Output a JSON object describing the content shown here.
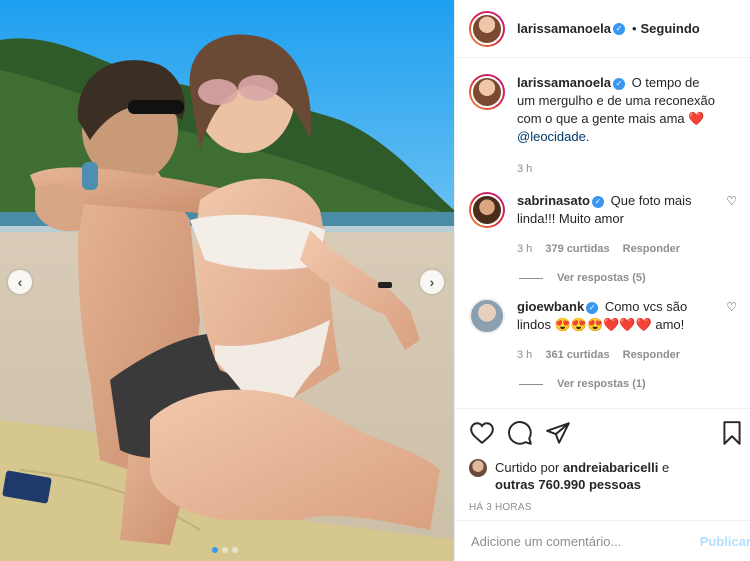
{
  "post": {
    "author": "larissamanoela",
    "follow_status": "Seguindo",
    "bullet": "•"
  },
  "caption": {
    "username": "larissamanoela",
    "text": "O tempo de um mergulho e de uma reconexão com o que a gente mais ama",
    "emoji": "❤️",
    "mention": "@leocidade.",
    "time": "3 h"
  },
  "comments": [
    {
      "username": "sabrinasato",
      "text": "Que foto mais linda!!! Muito amor",
      "time": "3 h",
      "likes": "379 curtidas",
      "reply": "Responder",
      "view_replies": "Ver respostas (5)"
    },
    {
      "username": "gioewbank",
      "text": "Como vcs são lindos",
      "emojis": "😍😍😍❤️❤️❤️",
      "text_end": "amo!",
      "time": "3 h",
      "likes": "361 curtidas",
      "reply": "Responder",
      "view_replies": "Ver respostas (1)"
    }
  ],
  "likes": {
    "prefix": "Curtido por",
    "user": "andreiabaricelli",
    "mid": "e",
    "others_prefix": "outras",
    "others_count": "760.990",
    "others_suffix": "pessoas"
  },
  "timestamp": "HÁ 3 HORAS",
  "composer": {
    "placeholder": "Adicione um comentário...",
    "publish": "Publicar"
  },
  "icons": {
    "like": "heart-icon",
    "comment": "comment-icon",
    "share": "paper-plane-icon",
    "save": "bookmark-icon",
    "verified": "verified-badge-icon",
    "prev": "chevron-left-icon",
    "next": "chevron-right-icon"
  },
  "colors": {
    "verified": "#3897f0",
    "link": "#00376b",
    "muted": "#8e8e8e",
    "publish": "#b2dffc",
    "heart": "#ed4956"
  },
  "carousel": {
    "slides": 3,
    "active": 1
  }
}
